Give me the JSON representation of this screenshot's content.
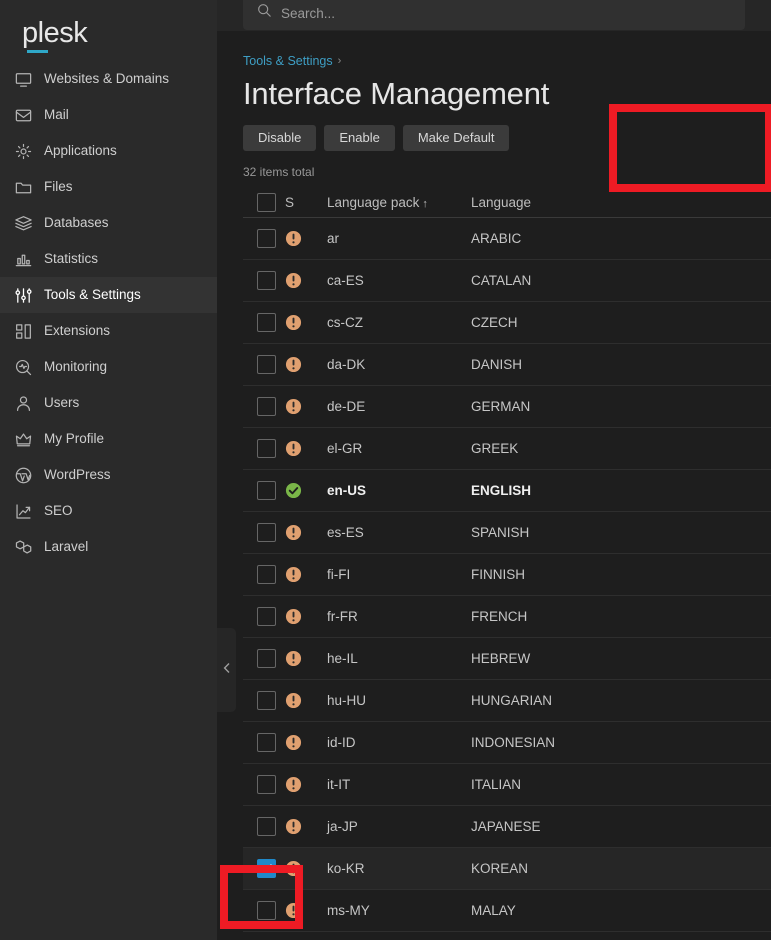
{
  "brand": {
    "name": "plesk"
  },
  "search": {
    "placeholder": "Search...",
    "value": "",
    "icon": "search-icon"
  },
  "sidebar": {
    "items": [
      {
        "label": "Websites & Domains",
        "icon": "monitor-icon",
        "active": false
      },
      {
        "label": "Mail",
        "icon": "envelope-icon",
        "active": false
      },
      {
        "label": "Applications",
        "icon": "gear-icon",
        "active": false
      },
      {
        "label": "Files",
        "icon": "folder-icon",
        "active": false
      },
      {
        "label": "Databases",
        "icon": "database-icon",
        "active": false
      },
      {
        "label": "Statistics",
        "icon": "bar-chart-icon",
        "active": false
      },
      {
        "label": "Tools & Settings",
        "icon": "sliders-icon",
        "active": true
      },
      {
        "label": "Extensions",
        "icon": "blocks-icon",
        "active": false
      },
      {
        "label": "Monitoring",
        "icon": "magnifier-pulse-icon",
        "active": false
      },
      {
        "label": "Users",
        "icon": "person-icon",
        "active": false
      },
      {
        "label": "My Profile",
        "icon": "crown-icon",
        "active": false
      },
      {
        "label": "WordPress",
        "icon": "wordpress-icon",
        "active": false
      },
      {
        "label": "SEO",
        "icon": "seo-arrow-icon",
        "active": false
      },
      {
        "label": "Laravel",
        "icon": "laravel-icon",
        "active": false
      }
    ]
  },
  "breadcrumb": {
    "parent": "Tools & Settings",
    "separator": "›"
  },
  "page": {
    "title": "Interface Management"
  },
  "toolbar": {
    "disable_label": "Disable",
    "enable_label": "Enable",
    "make_default_label": "Make Default"
  },
  "list": {
    "items_total": "32 items total",
    "columns": {
      "status": "S",
      "language_pack": "Language pack",
      "sort_indicator": "↑",
      "language": "Language"
    },
    "rows": [
      {
        "pack": "ar",
        "language": "ARABIC",
        "status": "warning",
        "checked": false,
        "default": false
      },
      {
        "pack": "ca-ES",
        "language": "CATALAN",
        "status": "warning",
        "checked": false,
        "default": false
      },
      {
        "pack": "cs-CZ",
        "language": "CZECH",
        "status": "warning",
        "checked": false,
        "default": false
      },
      {
        "pack": "da-DK",
        "language": "DANISH",
        "status": "warning",
        "checked": false,
        "default": false
      },
      {
        "pack": "de-DE",
        "language": "GERMAN",
        "status": "warning",
        "checked": false,
        "default": false
      },
      {
        "pack": "el-GR",
        "language": "GREEK",
        "status": "warning",
        "checked": false,
        "default": false
      },
      {
        "pack": "en-US",
        "language": "ENGLISH",
        "status": "ok",
        "checked": false,
        "default": true
      },
      {
        "pack": "es-ES",
        "language": "SPANISH",
        "status": "warning",
        "checked": false,
        "default": false
      },
      {
        "pack": "fi-FI",
        "language": "FINNISH",
        "status": "warning",
        "checked": false,
        "default": false
      },
      {
        "pack": "fr-FR",
        "language": "FRENCH",
        "status": "warning",
        "checked": false,
        "default": false
      },
      {
        "pack": "he-IL",
        "language": "HEBREW",
        "status": "warning",
        "checked": false,
        "default": false
      },
      {
        "pack": "hu-HU",
        "language": "HUNGARIAN",
        "status": "warning",
        "checked": false,
        "default": false
      },
      {
        "pack": "id-ID",
        "language": "INDONESIAN",
        "status": "warning",
        "checked": false,
        "default": false
      },
      {
        "pack": "it-IT",
        "language": "ITALIAN",
        "status": "warning",
        "checked": false,
        "default": false
      },
      {
        "pack": "ja-JP",
        "language": "JAPANESE",
        "status": "warning",
        "checked": false,
        "default": false
      },
      {
        "pack": "ko-KR",
        "language": "KOREAN",
        "status": "warning",
        "checked": true,
        "default": false
      },
      {
        "pack": "ms-MY",
        "language": "MALAY",
        "status": "warning",
        "checked": false,
        "default": false
      }
    ]
  },
  "colors": {
    "accent": "#2fa8c8",
    "link": "#3e9ec4",
    "checkbox_checked": "#2089c9",
    "status_warning": "#e0a070",
    "status_ok": "#7ab648",
    "annotation": "#ee1b24",
    "sidebar_bg": "#2a2a2a",
    "content_bg": "#1e1e1e"
  },
  "annotations": [
    {
      "name": "make-default-highlight",
      "target": "Make Default"
    },
    {
      "name": "korean-checkbox-highlight",
      "target": "ko-KR row checkbox"
    }
  ],
  "collapse_handle": {
    "icon": "chevron-left-icon"
  }
}
